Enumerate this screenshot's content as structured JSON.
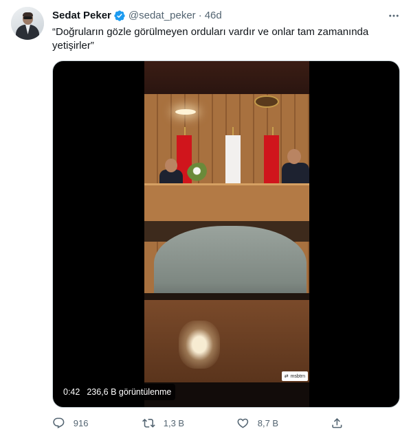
{
  "tweet": {
    "author": {
      "name": "Sedat Peker",
      "verified": true,
      "handle": "@sedat_peker",
      "separator": "·",
      "time": "46d"
    },
    "text": "“Doğruların gözle görülmeyen orduları vardır ve onlar tam zamanında yetişirler”",
    "media": {
      "type": "video",
      "duration": "0:42",
      "views": "236,6 B görüntülenme",
      "watermark": "msbtrn"
    },
    "actions": {
      "reply_count": "916",
      "retweet_count": "1,3 B",
      "like_count": "8,7 B"
    }
  },
  "colors": {
    "text_primary": "#0f1419",
    "text_secondary": "#536471",
    "verified_badge": "#1d9bf0",
    "border": "#cfd9de"
  },
  "icons": {
    "verified": "verified-badge-icon",
    "more": "more-dots-icon",
    "reply": "reply-bubble-icon",
    "retweet": "retweet-icon",
    "like": "heart-icon",
    "share": "share-upload-icon"
  }
}
